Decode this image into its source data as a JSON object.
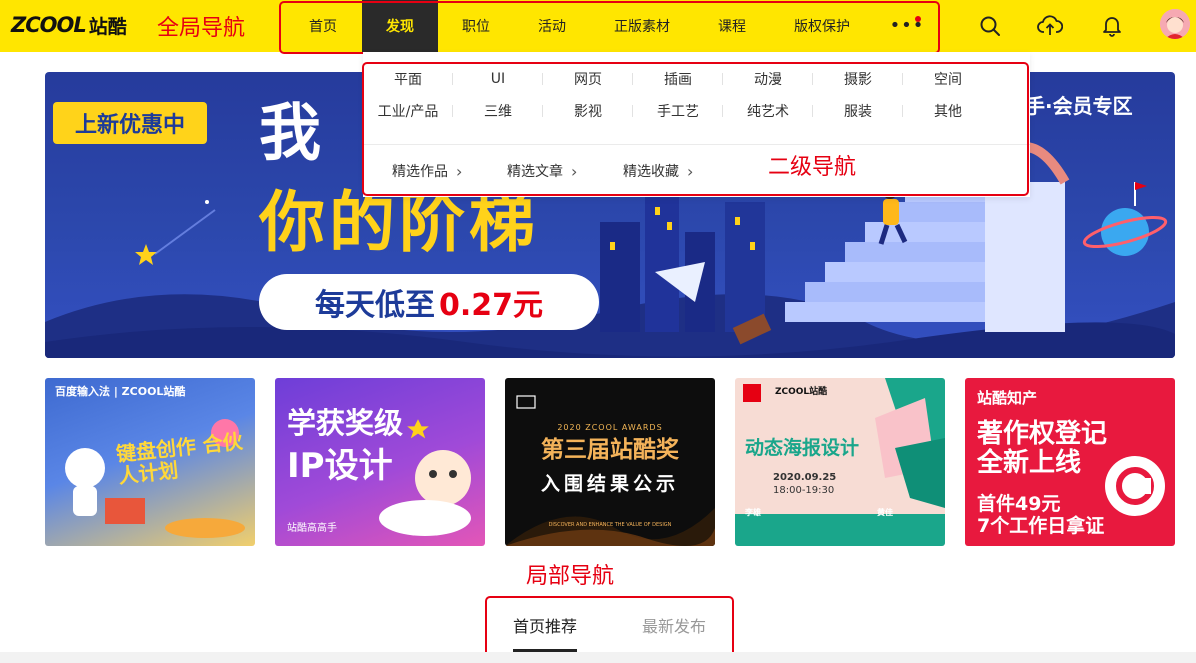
{
  "brand": {
    "logo_latin": "ZCOOL",
    "logo_cn": "站酷"
  },
  "annotations": {
    "global_nav": "全局导航",
    "secondary_nav": "二级导航",
    "local_nav": "局部导航"
  },
  "nav": {
    "items": [
      {
        "label": "首页"
      },
      {
        "label": "发现",
        "active": true
      },
      {
        "label": "职位"
      },
      {
        "label": "活动"
      },
      {
        "label": "正版素材"
      },
      {
        "label": "课程"
      },
      {
        "label": "版权保护"
      }
    ],
    "more_label": "•••"
  },
  "header_icons": [
    "search-icon",
    "upload-icon",
    "bell-icon",
    "avatar"
  ],
  "dropdown": {
    "categories": [
      "平面",
      "UI",
      "网页",
      "插画",
      "动漫",
      "摄影",
      "空间",
      "工业/产品",
      "三维",
      "影视",
      "手工艺",
      "纯艺术",
      "服装",
      "其他"
    ],
    "links": [
      "精选作品",
      "精选文章",
      "精选收藏"
    ],
    "chevron": "›"
  },
  "banner": {
    "tag": "上新优惠中",
    "line1": "我",
    "line2": "你的阶梯",
    "price_prefix": "每天低至",
    "price_value": "0.27元",
    "right_text": "手·会员专区"
  },
  "cards": [
    {
      "top": "百度输入法 | ZCOOL站酷",
      "title": "键盘创作 合伙人计划",
      "colors": [
        "#4a76d6",
        "#f4c45a"
      ]
    },
    {
      "top": "学获奖级",
      "title": "IP设计",
      "footer": "站酷高高手",
      "colors": [
        "#7b3fd6",
        "#e34fb0"
      ]
    },
    {
      "top": "2020 ZCOOL AWARDS",
      "title": "第三届站酷奖",
      "subtitle": "入围结果公示",
      "footer": "DISCOVER AND ENHANCE THE VALUE OF DESIGN",
      "colors": [
        "#0f0f0f",
        "#f0b14a"
      ]
    },
    {
      "top": "ZCOOL站酷",
      "title": "动态海报设计",
      "date": "2020.09.25",
      "time": "18:00-19:30",
      "people": [
        "李雄",
        "黄佳"
      ],
      "colors": [
        "#f6d6cf",
        "#1aa68b"
      ]
    },
    {
      "top": "站酷知产",
      "title": "著作权登记 全新上线",
      "line1": "首件49元",
      "line2": "7个工作日拿证",
      "colors": [
        "#e8193e",
        "#ffffff"
      ]
    }
  ],
  "local_tabs": [
    {
      "label": "首页推荐",
      "active": true
    },
    {
      "label": "最新发布"
    }
  ]
}
